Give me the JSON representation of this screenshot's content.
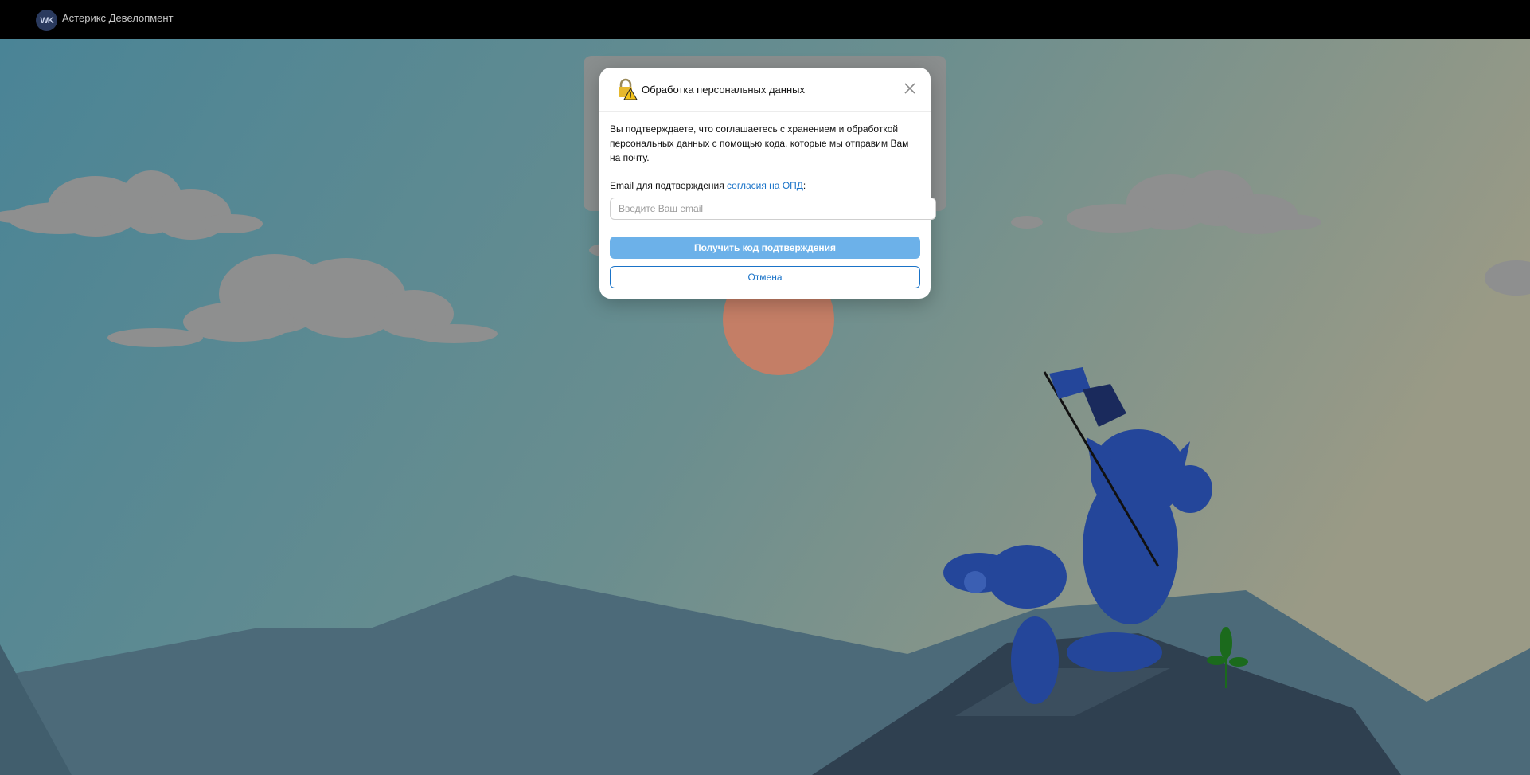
{
  "header": {
    "logo_text": "WK",
    "company_name": "Астерикс Девелопмент"
  },
  "dialog": {
    "title": "Обработка персональных данных",
    "description": "Вы подтверждаете, что соглашаетесь с хранением и обработкой персональных данных с помощью кода, которые мы отправим Вам на почту.",
    "email_label_prefix": "Email для подтверждения ",
    "email_label_link": "согласия на ОПД",
    "email_label_suffix": ":",
    "email_placeholder": "Введите Ваш email",
    "email_value": "",
    "primary_button": "Получить код подтверждения",
    "secondary_button": "Отмена"
  },
  "colors": {
    "accent": "#1a73c8",
    "primary_button_bg": "#6cb1e9",
    "topbar_bg": "#000000"
  },
  "icons": [
    "lock-warning-icon",
    "close-icon"
  ]
}
